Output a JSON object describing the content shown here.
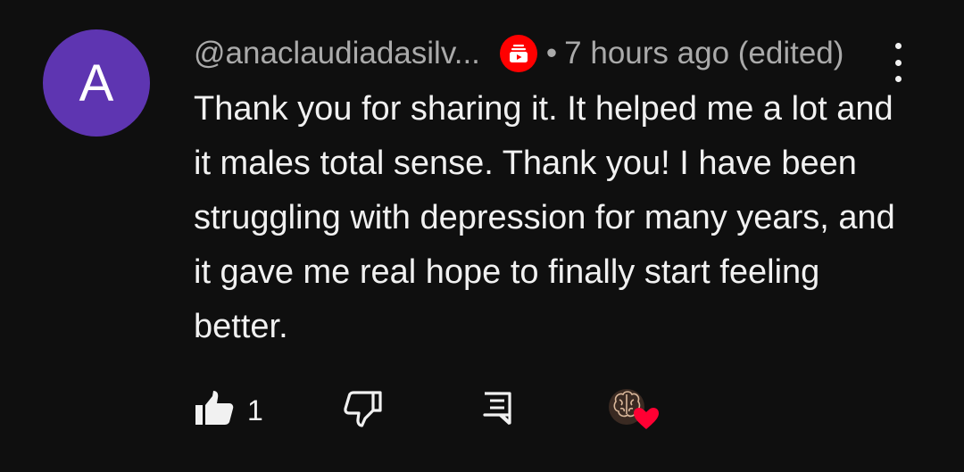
{
  "comment": {
    "avatar_letter": "A",
    "avatar_color": "#5e35b1",
    "username": "@anaclaudiadasilv...",
    "badge_icon": "youtube-member-badge-icon",
    "separator": "•",
    "timestamp": "7 hours ago (edited)",
    "text": "Thank you for sharing it. It helped  me a lot and it males total sense. Thank you! I have been struggling with depression for many years, and it gave me real hope to finally start feeling better.",
    "actions": {
      "like_icon": "thumbs-up-icon",
      "like_count": "1",
      "dislike_icon": "thumbs-down-icon",
      "reply_icon": "reply-comment-icon",
      "creator_heart_icon": "creator-heart-icon"
    }
  },
  "colors": {
    "background": "#0f0f0f",
    "text_primary": "#f1f1f1",
    "text_secondary": "#aaaaaa",
    "badge_red": "#ff0000",
    "heart_red": "#ff0033"
  }
}
